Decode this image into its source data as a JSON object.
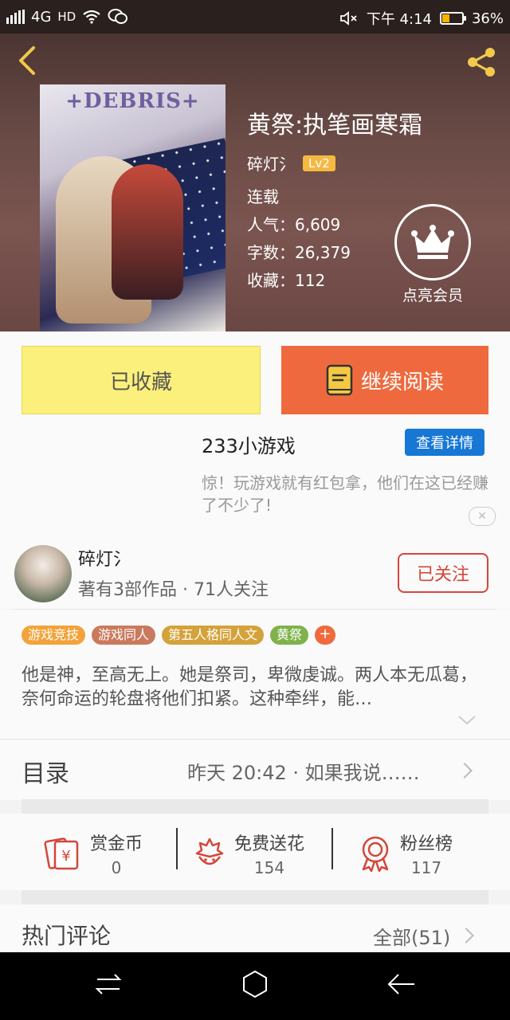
{
  "status_bar": {
    "network": "4G",
    "hd": "HD",
    "time": "下午 4:14",
    "battery": "36%"
  },
  "book": {
    "cover_title": "+DEBRIS+",
    "title": "黄祭:执笔画寒霜",
    "author": "碎灯氵",
    "level": "Lv2",
    "status": "连载",
    "popularity": "人气：6,609",
    "words": "字数：26,379",
    "favorites": "收藏：112"
  },
  "vip": {
    "label": "点亮会员"
  },
  "actions": {
    "favorited_label": "已收藏",
    "continue_label": "继续阅读"
  },
  "ad": {
    "title": "233小游戏",
    "button": "查看详情",
    "description": "惊！玩游戏就有红包拿，他们在这已经赚了不少了!"
  },
  "author_section": {
    "name": "碎灯氵",
    "info": "著有3部作品 · 71人关注",
    "follow_label": "已关注"
  },
  "tags": [
    {
      "label": "游戏竞技",
      "color": "#f2a33a"
    },
    {
      "label": "游戏同人",
      "color": "#c97a5e"
    },
    {
      "label": "第五人格同人文",
      "color": "#d4a23a"
    },
    {
      "label": "黄祭",
      "color": "#7fb24a"
    },
    {
      "label": "+",
      "color": "#ef6a3c"
    }
  ],
  "synopsis": "他是神，至高无上。她是祭司，卑微虔诚。两人本无瓜葛，奈何命运的轮盘将他们扣紧。这种牵绊，能…",
  "catalog": {
    "label": "目录",
    "latest": "昨天 20:42 · 如果我说……"
  },
  "stats": [
    {
      "label": "赏金币",
      "value": "0",
      "icon": "reward-coin-icon"
    },
    {
      "label": "免费送花",
      "value": "154",
      "icon": "flower-icon"
    },
    {
      "label": "粉丝榜",
      "value": "117",
      "icon": "medal-icon"
    }
  ],
  "comments": {
    "title": "热门评论",
    "all_label": "全部(51)"
  },
  "colors": {
    "accent_orange": "#ee6a3e",
    "favorite_yellow": "#fbf07b",
    "follow_red": "#d4463a",
    "ad_blue": "#1777d4",
    "icon_red": "#d4463a"
  }
}
